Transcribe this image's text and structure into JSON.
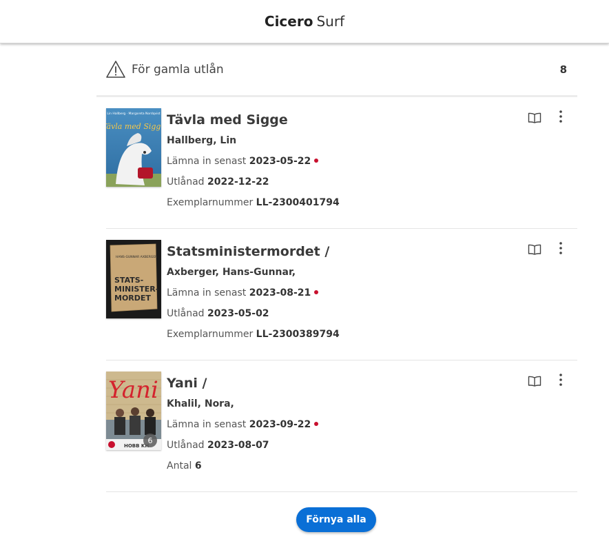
{
  "app": {
    "title_bold": "Cicero",
    "title_light": "Surf"
  },
  "section": {
    "title": "För gamla utlån",
    "count": "8",
    "icon": "warning-triangle-icon"
  },
  "labels": {
    "due": "Lämna in senast",
    "loaned": "Utlånad",
    "copy": "Exemplarnummer",
    "quantity": "Antal"
  },
  "loans": [
    {
      "title": "Tävla med Sigge",
      "author": "Hallberg, Lin",
      "due_date": "2023-05-22",
      "loaned_date": "2022-12-22",
      "copy_number": "LL-2300401794",
      "cover_title": "Tävla med Sigge",
      "cover_authors": "Lin Hallberg · Margareta Nordqvist"
    },
    {
      "title": "Statsministermordet /",
      "author": "Axberger, Hans-Gunnar,",
      "due_date": "2023-08-21",
      "loaned_date": "2023-05-02",
      "copy_number": "LL-2300389794",
      "cover_title_1": "STATS-",
      "cover_title_2": "MINISTER-",
      "cover_title_3": "MORDET",
      "cover_author": "HANS-GUNNAR AXBERGER"
    },
    {
      "title": "Yani /",
      "author": "Khalil, Nora,",
      "due_date": "2023-09-22",
      "loaned_date": "2023-08-07",
      "quantity": "6",
      "cover_title": "Yani",
      "cover_subtitle": "HOBB KH",
      "cover_badge": "6"
    }
  ],
  "actions": {
    "renew_all": "Förnya alla"
  },
  "colors": {
    "accent": "#0a6fd6",
    "due_dot": "#c8102e"
  }
}
